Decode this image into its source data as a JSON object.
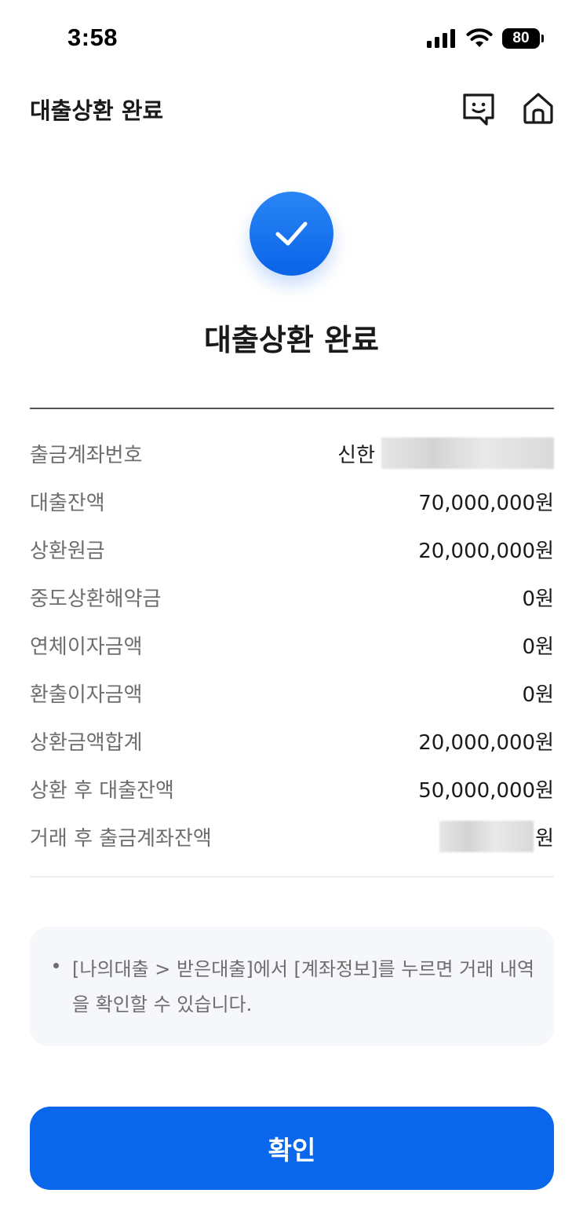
{
  "status_bar": {
    "time": "3:58",
    "battery_level": "80",
    "icons": [
      "signal-icon",
      "wifi-icon",
      "battery-icon"
    ]
  },
  "header": {
    "title": "대출상환 완료",
    "icons": [
      "chat-icon",
      "home-icon"
    ]
  },
  "result": {
    "icon": "check-icon",
    "title": "대출상환 완료",
    "accent_color": "#0a66eb"
  },
  "details": {
    "withdrawal_account": {
      "label": "출금계좌번호",
      "bank": "신한"
    },
    "loan_balance": {
      "label": "대출잔액",
      "value": "70,000,000원"
    },
    "repayment_principal": {
      "label": "상환원금",
      "value": "20,000,000원"
    },
    "early_repayment_fee": {
      "label": "중도상환해약금",
      "value": "0원"
    },
    "overdue_interest": {
      "label": "연체이자금액",
      "value": "0원"
    },
    "refund_interest": {
      "label": "환출이자금액",
      "value": "0원"
    },
    "repayment_total": {
      "label": "상환금액합계",
      "value": "20,000,000원"
    },
    "balance_after": {
      "label": "상환 후 대출잔액",
      "value": "50,000,000원"
    },
    "account_balance_after": {
      "label": "거래 후 출금계좌잔액",
      "unit": "원"
    }
  },
  "info": {
    "text": "[나의대출 > 받은대출]에서 [계좌정보]를 누르면 거래 내역을 확인할 수 있습니다."
  },
  "confirm_button": {
    "label": "확인"
  }
}
